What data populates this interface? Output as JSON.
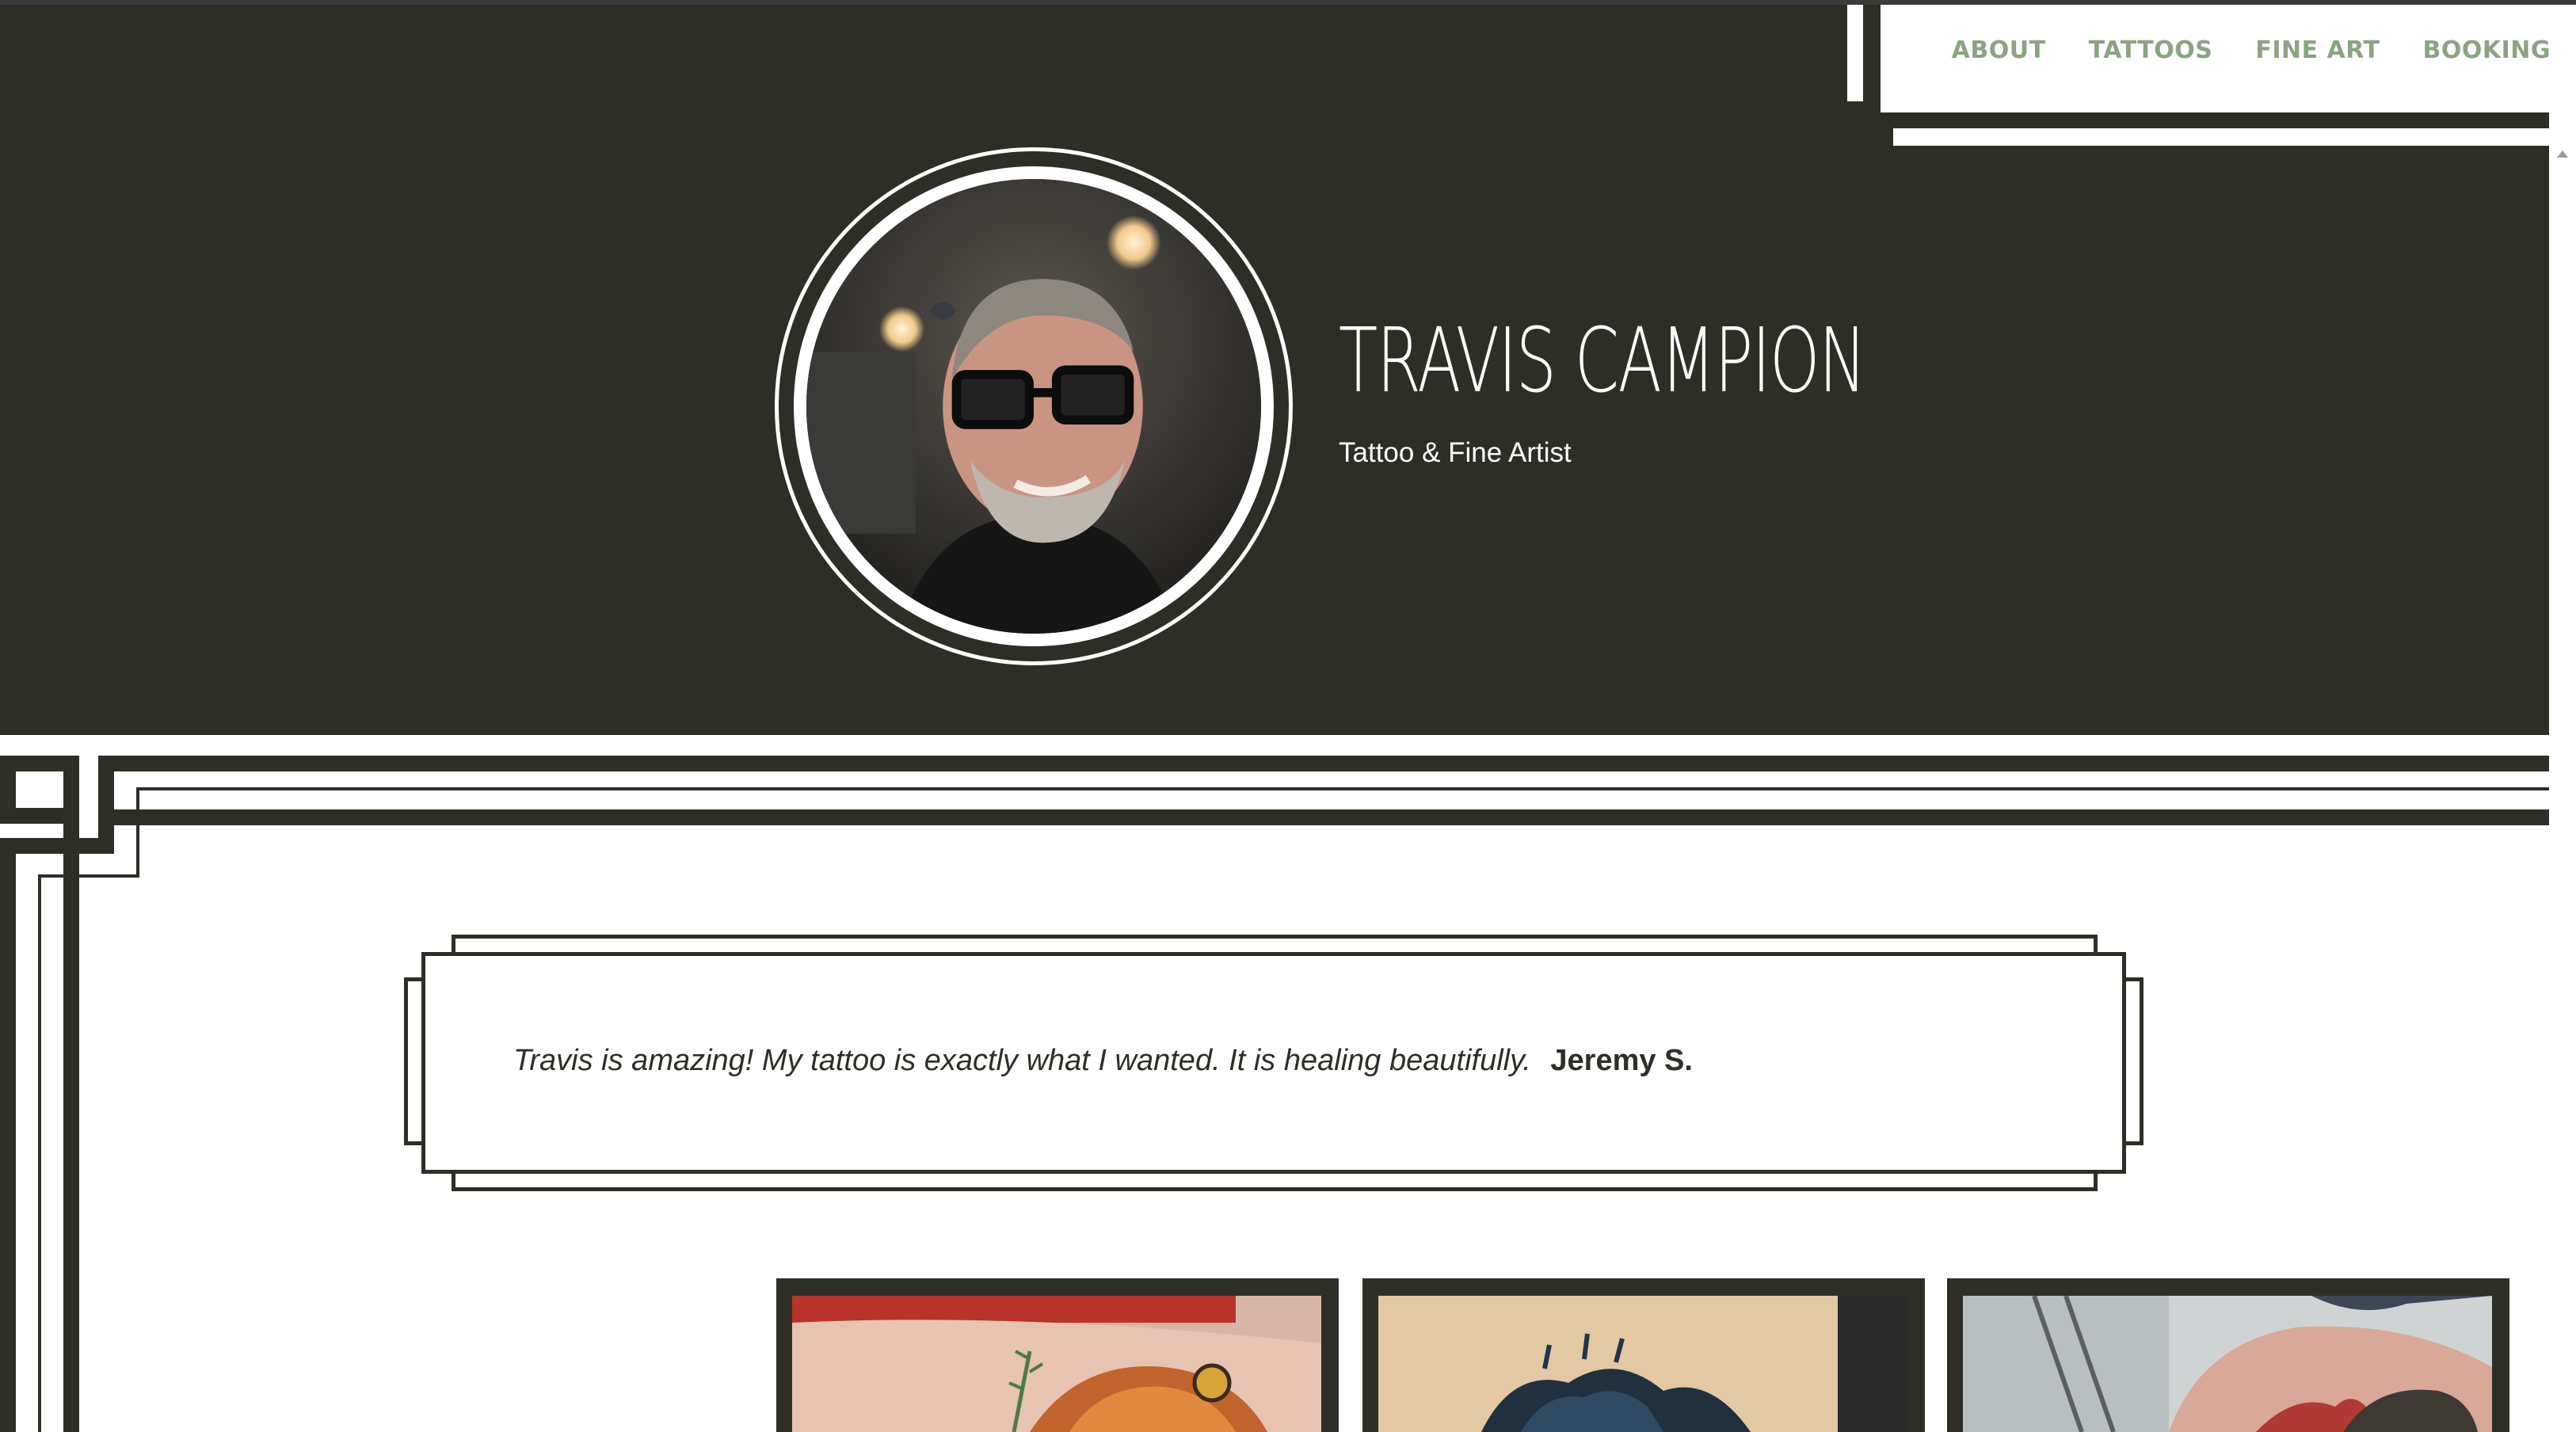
{
  "nav": {
    "items": [
      "ABOUT",
      "TATTOOS",
      "FINE ART",
      "BOOKING"
    ]
  },
  "artist": {
    "name": "TRAVIS CAMPION",
    "tagline": "Tattoo & Fine Artist"
  },
  "testimonial": {
    "quote": "Travis is amazing! My tattoo is exactly what I wanted. It is healing beautifully.",
    "author": "Jeremy S."
  },
  "colors": {
    "background_dark": "#2d2f27",
    "nav_link": "#8aa482",
    "white": "#ffffff"
  },
  "icons": {
    "scroll_up": "triangle-up"
  }
}
